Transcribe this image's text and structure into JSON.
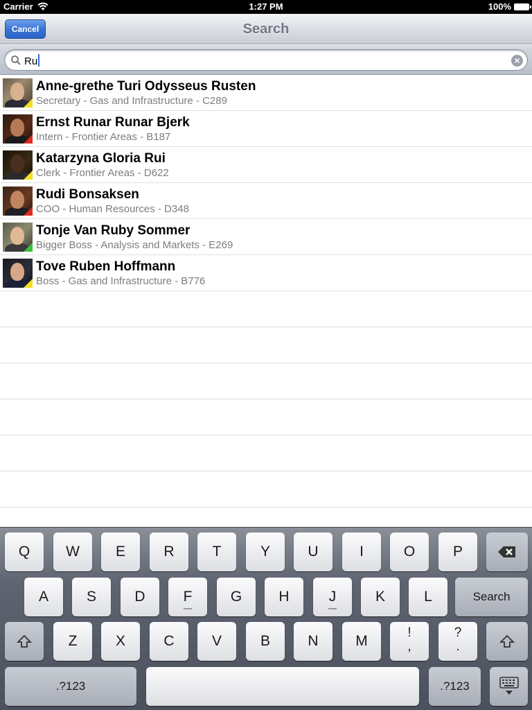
{
  "status_bar": {
    "carrier": "Carrier",
    "time": "1:27 PM",
    "battery": "100%"
  },
  "nav": {
    "title": "Search",
    "cancel_label": "Cancel"
  },
  "search": {
    "value": "Ru"
  },
  "results": [
    {
      "name": "Anne-grethe Turi Odysseus Rusten",
      "subtitle": "Secretary - Gas and Infrastructure - C289",
      "status_color": "#f0e020"
    },
    {
      "name": "Ernst Runar Runar Bjerk",
      "subtitle": "Intern - Frontier Areas - B187",
      "status_color": "#e02a20"
    },
    {
      "name": "Katarzyna Gloria Rui",
      "subtitle": "Clerk - Frontier Areas - D622",
      "status_color": "#f0e020"
    },
    {
      "name": "Rudi Bonsaksen",
      "subtitle": "COO - Human Resources - D348",
      "status_color": "#e02a20"
    },
    {
      "name": "Tonje Van Ruby Sommer",
      "subtitle": "Bigger Boss - Analysis and Markets - E269",
      "status_color": "#3cc03c"
    },
    {
      "name": "Tove Ruben Hoffmann",
      "subtitle": "Boss - Gas and Infrastructure - B776",
      "status_color": "#f0e020"
    }
  ],
  "keyboard": {
    "row1": [
      "Q",
      "W",
      "E",
      "R",
      "T",
      "Y",
      "U",
      "I",
      "O",
      "P"
    ],
    "row2": [
      "A",
      "S",
      "D",
      "F",
      "G",
      "H",
      "J",
      "K",
      "L"
    ],
    "row3": [
      "Z",
      "X",
      "C",
      "V",
      "B",
      "N",
      "M"
    ],
    "excl_top": "!",
    "excl_bottom": ",",
    "quest_top": "?",
    "quest_bottom": ".",
    "search_label": "Search",
    "numbers_label": ".?123",
    "icons": {
      "backspace": "backspace-icon",
      "shift": "shift-icon",
      "dismiss": "keyboard-dismiss-icon"
    }
  }
}
